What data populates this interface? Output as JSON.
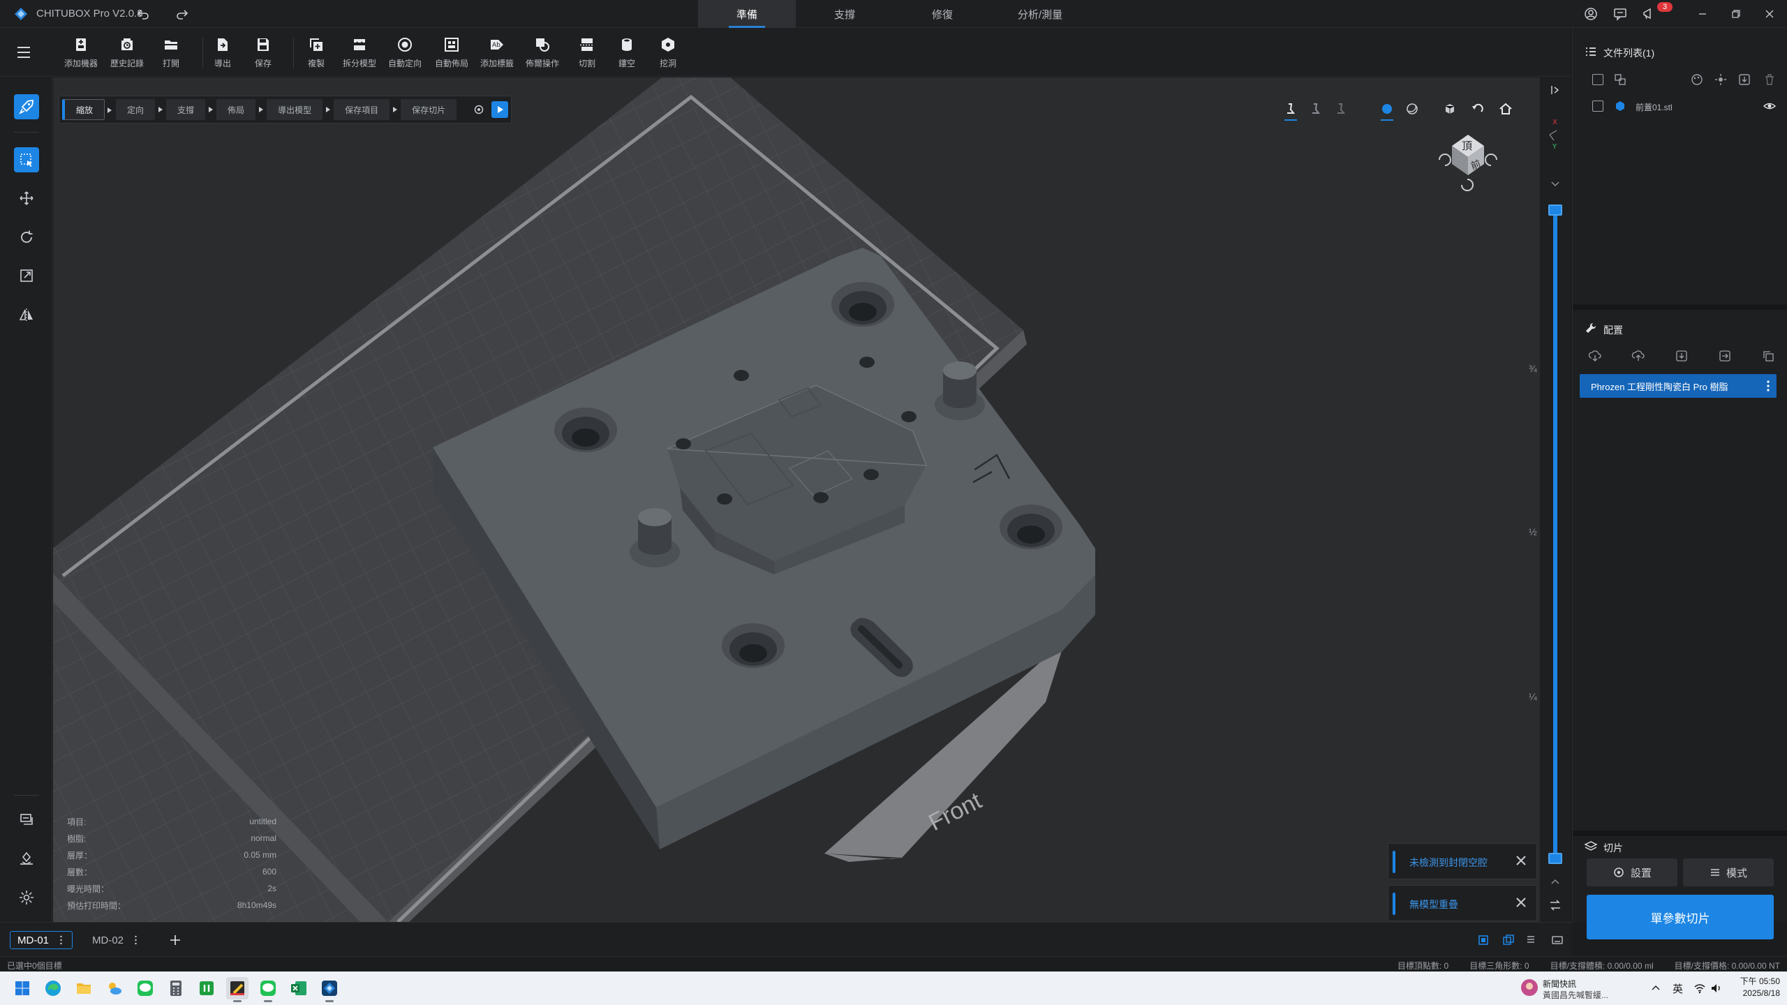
{
  "app": {
    "title": "CHITUBOX Pro V2.0.8"
  },
  "top_tabs": [
    {
      "label": "準備",
      "active": true
    },
    {
      "label": "支撐",
      "active": false
    },
    {
      "label": "修復",
      "active": false
    },
    {
      "label": "分析/測量",
      "active": false
    }
  ],
  "notification_count": "3",
  "toolbar": [
    {
      "label": "添加機器",
      "icon": "add-printer-icon"
    },
    {
      "label": "歷史記錄",
      "icon": "history-icon"
    },
    {
      "label": "打開",
      "icon": "folder-open-icon"
    },
    {
      "label": "導出",
      "icon": "export-icon"
    },
    {
      "label": "保存",
      "icon": "save-icon"
    },
    {
      "label": "複製",
      "icon": "copy-icon"
    },
    {
      "label": "拆分模型",
      "icon": "split-model-icon"
    },
    {
      "label": "自動定向",
      "icon": "auto-orient-icon"
    },
    {
      "label": "自動佈局",
      "icon": "auto-layout-icon"
    },
    {
      "label": "添加標籤",
      "icon": "add-label-icon"
    },
    {
      "label": "佈爾操作",
      "icon": "boolean-icon"
    },
    {
      "label": "切割",
      "icon": "cut-icon"
    },
    {
      "label": "鏤空",
      "icon": "hollow-icon"
    },
    {
      "label": "挖洞",
      "icon": "drill-hole-icon"
    }
  ],
  "workflow": [
    {
      "label": "縮放",
      "active": true
    },
    {
      "label": "定向",
      "active": false
    },
    {
      "label": "支撐",
      "active": false
    },
    {
      "label": "佈局",
      "active": false
    },
    {
      "label": "導出模型",
      "active": false
    },
    {
      "label": "保存項目",
      "active": false
    },
    {
      "label": "保存切片",
      "active": false
    }
  ],
  "view_cube": {
    "top": "頂",
    "front": "前"
  },
  "bed_label": "Front",
  "slider_fractions": [
    "¾",
    "½",
    "¼"
  ],
  "info_panel": [
    {
      "label": "項目:",
      "value": "untitled"
    },
    {
      "label": "樹脂:",
      "value": "normal"
    },
    {
      "label": "層厚：",
      "value": "0.05 mm"
    },
    {
      "label": "層數：",
      "value": "600"
    },
    {
      "label": "曝光時間：",
      "value": "2s"
    },
    {
      "label": "預估打印時間：",
      "value": "8h10m49s"
    }
  ],
  "notifications": [
    {
      "text": "未檢測到封閉空腔"
    },
    {
      "text": "無模型重疊"
    }
  ],
  "right_panel": {
    "file_list_title": "文件列表(1)",
    "file_item": "前蓋01.stl",
    "config_title": "配置",
    "profile": "Phrozen 工程剛性陶瓷白 Pro 樹脂",
    "slice_title": "切片",
    "settings_label": "設置",
    "mode_label": "模式",
    "slice_button": "單參數切片"
  },
  "file_tabs": [
    {
      "label": "MD-01",
      "active": true
    },
    {
      "label": "MD-02",
      "active": false
    }
  ],
  "status": {
    "left": "已選中0個目標",
    "vertices": "目標頂點數: 0",
    "triangles": "目標三角形數: 0",
    "volume": "目標/支撐體積: 0.00/0.00 ml",
    "price": "目標/支撐價格: 0.00/0.00 NT"
  },
  "taskbar": {
    "news_title": "新聞快訊",
    "news_sub": "黃國昌先喊暫緩...",
    "ime": "英",
    "time": "下午 05:50",
    "date": "2025/8/18"
  },
  "colors": {
    "accent": "#1d86e5",
    "panel": "#1e1f21",
    "viewport": "#2b2c2e",
    "model": "#555a5f",
    "badge": "#e0373c"
  }
}
